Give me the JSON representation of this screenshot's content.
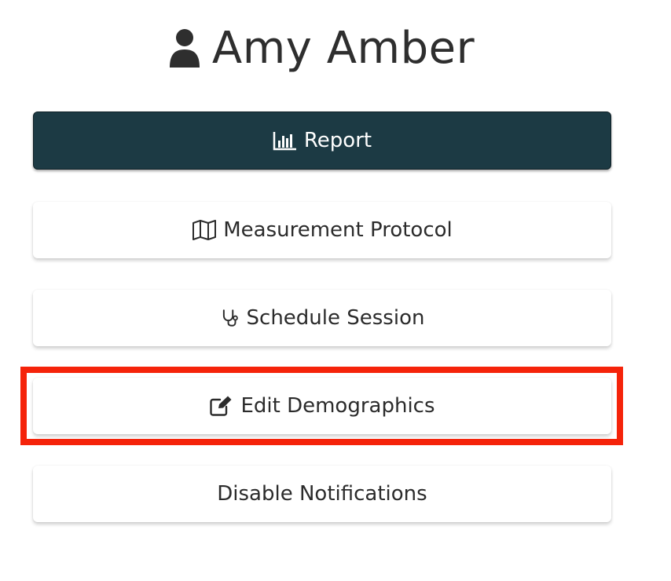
{
  "header": {
    "user_icon": "user-icon",
    "name": "Amy Amber"
  },
  "actions": {
    "report": {
      "label": "Report",
      "icon": "bar-chart-icon"
    },
    "measurement_protocol": {
      "label": "Measurement Protocol",
      "icon": "map-icon"
    },
    "schedule_session": {
      "label": "Schedule Session",
      "icon": "stethoscope-icon"
    },
    "edit_demographics": {
      "label": "Edit Demographics",
      "icon": "edit-icon"
    },
    "disable_notifications": {
      "label": "Disable Notifications"
    }
  },
  "colors": {
    "primary_button": "#1c3a44",
    "highlight_border": "#f5230a",
    "text": "#2b2b2b"
  }
}
